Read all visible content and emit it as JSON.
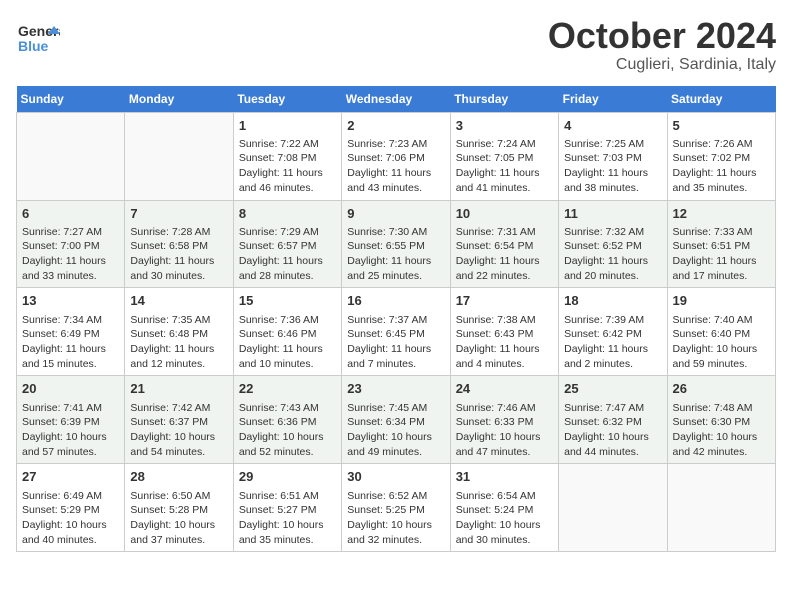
{
  "header": {
    "logo_line1": "General",
    "logo_line2": "Blue",
    "month": "October 2024",
    "location": "Cuglieri, Sardinia, Italy"
  },
  "weekdays": [
    "Sunday",
    "Monday",
    "Tuesday",
    "Wednesday",
    "Thursday",
    "Friday",
    "Saturday"
  ],
  "weeks": [
    [
      {
        "day": "",
        "sunrise": "",
        "sunset": "",
        "daylight": ""
      },
      {
        "day": "",
        "sunrise": "",
        "sunset": "",
        "daylight": ""
      },
      {
        "day": "1",
        "sunrise": "Sunrise: 7:22 AM",
        "sunset": "Sunset: 7:08 PM",
        "daylight": "Daylight: 11 hours and 46 minutes."
      },
      {
        "day": "2",
        "sunrise": "Sunrise: 7:23 AM",
        "sunset": "Sunset: 7:06 PM",
        "daylight": "Daylight: 11 hours and 43 minutes."
      },
      {
        "day": "3",
        "sunrise": "Sunrise: 7:24 AM",
        "sunset": "Sunset: 7:05 PM",
        "daylight": "Daylight: 11 hours and 41 minutes."
      },
      {
        "day": "4",
        "sunrise": "Sunrise: 7:25 AM",
        "sunset": "Sunset: 7:03 PM",
        "daylight": "Daylight: 11 hours and 38 minutes."
      },
      {
        "day": "5",
        "sunrise": "Sunrise: 7:26 AM",
        "sunset": "Sunset: 7:02 PM",
        "daylight": "Daylight: 11 hours and 35 minutes."
      }
    ],
    [
      {
        "day": "6",
        "sunrise": "Sunrise: 7:27 AM",
        "sunset": "Sunset: 7:00 PM",
        "daylight": "Daylight: 11 hours and 33 minutes."
      },
      {
        "day": "7",
        "sunrise": "Sunrise: 7:28 AM",
        "sunset": "Sunset: 6:58 PM",
        "daylight": "Daylight: 11 hours and 30 minutes."
      },
      {
        "day": "8",
        "sunrise": "Sunrise: 7:29 AM",
        "sunset": "Sunset: 6:57 PM",
        "daylight": "Daylight: 11 hours and 28 minutes."
      },
      {
        "day": "9",
        "sunrise": "Sunrise: 7:30 AM",
        "sunset": "Sunset: 6:55 PM",
        "daylight": "Daylight: 11 hours and 25 minutes."
      },
      {
        "day": "10",
        "sunrise": "Sunrise: 7:31 AM",
        "sunset": "Sunset: 6:54 PM",
        "daylight": "Daylight: 11 hours and 22 minutes."
      },
      {
        "day": "11",
        "sunrise": "Sunrise: 7:32 AM",
        "sunset": "Sunset: 6:52 PM",
        "daylight": "Daylight: 11 hours and 20 minutes."
      },
      {
        "day": "12",
        "sunrise": "Sunrise: 7:33 AM",
        "sunset": "Sunset: 6:51 PM",
        "daylight": "Daylight: 11 hours and 17 minutes."
      }
    ],
    [
      {
        "day": "13",
        "sunrise": "Sunrise: 7:34 AM",
        "sunset": "Sunset: 6:49 PM",
        "daylight": "Daylight: 11 hours and 15 minutes."
      },
      {
        "day": "14",
        "sunrise": "Sunrise: 7:35 AM",
        "sunset": "Sunset: 6:48 PM",
        "daylight": "Daylight: 11 hours and 12 minutes."
      },
      {
        "day": "15",
        "sunrise": "Sunrise: 7:36 AM",
        "sunset": "Sunset: 6:46 PM",
        "daylight": "Daylight: 11 hours and 10 minutes."
      },
      {
        "day": "16",
        "sunrise": "Sunrise: 7:37 AM",
        "sunset": "Sunset: 6:45 PM",
        "daylight": "Daylight: 11 hours and 7 minutes."
      },
      {
        "day": "17",
        "sunrise": "Sunrise: 7:38 AM",
        "sunset": "Sunset: 6:43 PM",
        "daylight": "Daylight: 11 hours and 4 minutes."
      },
      {
        "day": "18",
        "sunrise": "Sunrise: 7:39 AM",
        "sunset": "Sunset: 6:42 PM",
        "daylight": "Daylight: 11 hours and 2 minutes."
      },
      {
        "day": "19",
        "sunrise": "Sunrise: 7:40 AM",
        "sunset": "Sunset: 6:40 PM",
        "daylight": "Daylight: 10 hours and 59 minutes."
      }
    ],
    [
      {
        "day": "20",
        "sunrise": "Sunrise: 7:41 AM",
        "sunset": "Sunset: 6:39 PM",
        "daylight": "Daylight: 10 hours and 57 minutes."
      },
      {
        "day": "21",
        "sunrise": "Sunrise: 7:42 AM",
        "sunset": "Sunset: 6:37 PM",
        "daylight": "Daylight: 10 hours and 54 minutes."
      },
      {
        "day": "22",
        "sunrise": "Sunrise: 7:43 AM",
        "sunset": "Sunset: 6:36 PM",
        "daylight": "Daylight: 10 hours and 52 minutes."
      },
      {
        "day": "23",
        "sunrise": "Sunrise: 7:45 AM",
        "sunset": "Sunset: 6:34 PM",
        "daylight": "Daylight: 10 hours and 49 minutes."
      },
      {
        "day": "24",
        "sunrise": "Sunrise: 7:46 AM",
        "sunset": "Sunset: 6:33 PM",
        "daylight": "Daylight: 10 hours and 47 minutes."
      },
      {
        "day": "25",
        "sunrise": "Sunrise: 7:47 AM",
        "sunset": "Sunset: 6:32 PM",
        "daylight": "Daylight: 10 hours and 44 minutes."
      },
      {
        "day": "26",
        "sunrise": "Sunrise: 7:48 AM",
        "sunset": "Sunset: 6:30 PM",
        "daylight": "Daylight: 10 hours and 42 minutes."
      }
    ],
    [
      {
        "day": "27",
        "sunrise": "Sunrise: 6:49 AM",
        "sunset": "Sunset: 5:29 PM",
        "daylight": "Daylight: 10 hours and 40 minutes."
      },
      {
        "day": "28",
        "sunrise": "Sunrise: 6:50 AM",
        "sunset": "Sunset: 5:28 PM",
        "daylight": "Daylight: 10 hours and 37 minutes."
      },
      {
        "day": "29",
        "sunrise": "Sunrise: 6:51 AM",
        "sunset": "Sunset: 5:27 PM",
        "daylight": "Daylight: 10 hours and 35 minutes."
      },
      {
        "day": "30",
        "sunrise": "Sunrise: 6:52 AM",
        "sunset": "Sunset: 5:25 PM",
        "daylight": "Daylight: 10 hours and 32 minutes."
      },
      {
        "day": "31",
        "sunrise": "Sunrise: 6:54 AM",
        "sunset": "Sunset: 5:24 PM",
        "daylight": "Daylight: 10 hours and 30 minutes."
      },
      {
        "day": "",
        "sunrise": "",
        "sunset": "",
        "daylight": ""
      },
      {
        "day": "",
        "sunrise": "",
        "sunset": "",
        "daylight": ""
      }
    ]
  ]
}
